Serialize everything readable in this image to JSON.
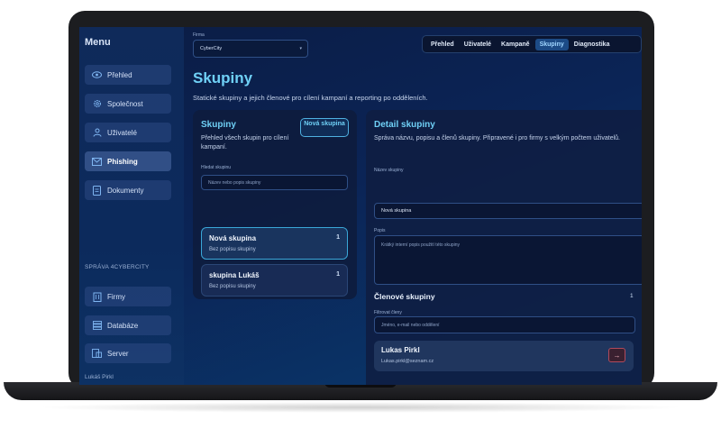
{
  "sidebar": {
    "title": "Menu",
    "items": [
      {
        "label": "Přehled",
        "icon": "eye-icon"
      },
      {
        "label": "Společnost",
        "icon": "gear-icon"
      },
      {
        "label": "Uživatelé",
        "icon": "user-icon"
      },
      {
        "label": "Phishing",
        "icon": "mail-icon"
      },
      {
        "label": "Dokumenty",
        "icon": "document-icon"
      }
    ],
    "section_label": "SPRÁVA 4CYBERCITY",
    "admin_items": [
      {
        "label": "Firmy",
        "icon": "building-icon"
      },
      {
        "label": "Databáze",
        "icon": "database-icon"
      },
      {
        "label": "Server",
        "icon": "server-icon"
      }
    ],
    "user_name": "Lukáš Pirkl"
  },
  "topbar": {
    "firma_label": "Firma",
    "firma_value": "CyberCity",
    "tabs": [
      "Přehled",
      "Uživatelé",
      "Kampaně",
      "Skupiny",
      "Diagnostika"
    ],
    "active_tab": "Skupiny"
  },
  "page": {
    "title": "Skupiny",
    "subtitle": "Statické skupiny a jejich členové pro cílení kampaní a reporting po odděleních."
  },
  "groups_panel": {
    "title": "Skupiny",
    "description": "Přehled všech skupin pro cílení kampaní.",
    "new_button": "Nová skupina",
    "search_label": "Hledat skupinu",
    "search_placeholder": "Název nebo popis skupiny",
    "groups": [
      {
        "name": "Nová skupina",
        "description": "Bez popisu skupiny",
        "count": "1"
      },
      {
        "name": "skupina Lukáš",
        "description": "Bez popisu skupiny",
        "count": "1"
      }
    ]
  },
  "detail_panel": {
    "title": "Detail skupiny",
    "description": "Správa názvu, popisu a členů skupiny. Připravené i pro firmy s velkým počtem uživatelů.",
    "name_label": "Název skupiny",
    "name_value": "Nová skupina",
    "desc_label": "Popis",
    "desc_placeholder": "Krátký interní popis použití této skupiny",
    "members_title": "Členové skupiny",
    "members_count": "1",
    "filter_label": "Filtrovat členy",
    "filter_placeholder": "Jméno, e-mail nebo oddělení",
    "members": [
      {
        "name": "Lukas Pirkl",
        "email": "Lukas.pirkl@seznam.cz",
        "action_icon": "arrow-right-icon"
      }
    ]
  }
}
